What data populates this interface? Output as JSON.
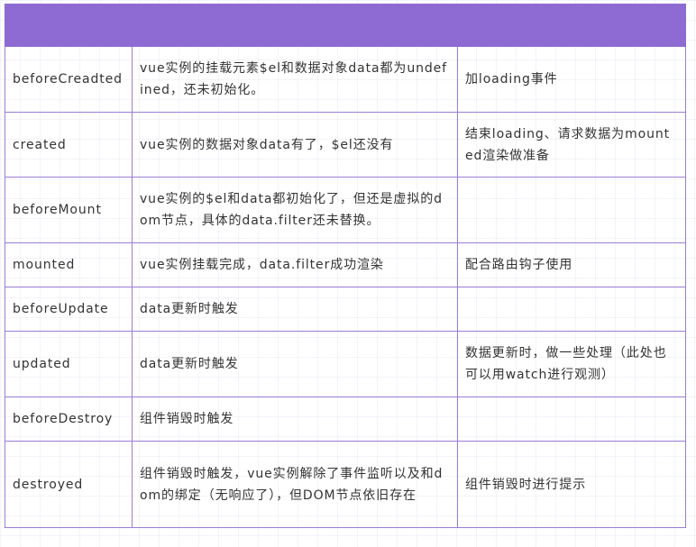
{
  "table": {
    "header": [
      "",
      "",
      ""
    ],
    "rows": [
      [
        "beforeCreadted",
        "vue实例的挂载元素$el和数据对象data都为undefined，还未初始化。",
        "加loading事件"
      ],
      [
        "created",
        "vue实例的数据对象data有了，$el还没有",
        "结束loading、请求数据为mounted渲染做准备"
      ],
      [
        "beforeMount",
        "vue实例的$el和data都初始化了，但还是虚拟的dom节点，具体的data.filter还未替换。",
        ""
      ],
      [
        "mounted",
        "vue实例挂载完成，data.filter成功渲染",
        "配合路由钩子使用"
      ],
      [
        "beforeUpdate",
        "data更新时触发",
        ""
      ],
      [
        "updated",
        "data更新时触发",
        "数据更新时，做一些处理（此处也可以用watch进行观测）"
      ],
      [
        "beforeDestroy",
        "组件销毁时触发",
        ""
      ],
      [
        "destroyed",
        "组件销毁时触发，vue实例解除了事件监听以及和dom的绑定（无响应了），但DOM节点依旧存在",
        "组件销毁时进行提示"
      ]
    ]
  },
  "colors": {
    "header_bg": "#8e6ad3",
    "border": "#9b7dd4",
    "text": "#333333"
  }
}
